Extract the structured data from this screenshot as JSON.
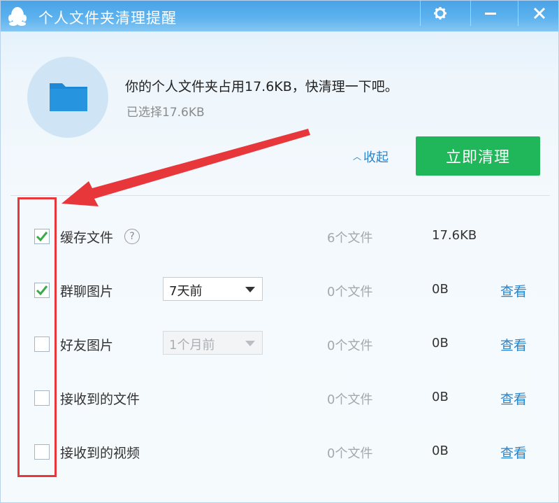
{
  "window": {
    "title": "个人文件夹清理提醒",
    "buttons": {
      "settings": "settings",
      "minimize": "minimize",
      "close": "close"
    }
  },
  "header": {
    "message": "你的个人文件夹占用17.6KB，快清理一下吧。",
    "selected": "已选择17.6KB",
    "collapse_label": "收起",
    "clean_button": "立即清理"
  },
  "rows": [
    {
      "label": "缓存文件",
      "checked": true,
      "help": "?",
      "count": "6个文件",
      "size": "17.6KB"
    },
    {
      "label": "群聊图片",
      "checked": true,
      "select": "7天前",
      "select_disabled": false,
      "count": "0个文件",
      "size": "0B",
      "view": "查看"
    },
    {
      "label": "好友图片",
      "checked": false,
      "select": "1个月前",
      "select_disabled": true,
      "count": "0个文件",
      "size": "0B",
      "view": "查看"
    },
    {
      "label": "接收到的文件",
      "checked": false,
      "count": "0个文件",
      "size": "0B",
      "view": "查看"
    },
    {
      "label": "接收到的视频",
      "checked": false,
      "count": "0个文件",
      "size": "0B",
      "view": "查看"
    }
  ],
  "colors": {
    "titlebar": "#4aa3e6",
    "accent_green": "#1fb75a",
    "link_blue": "#2b83c9",
    "annotation_red": "#e8373b",
    "check_green": "#3aa94a"
  },
  "icons": [
    "qq-penguin-icon",
    "gear-icon",
    "minimize-icon",
    "close-icon",
    "folder-icon",
    "chevron-up-icon",
    "help-icon",
    "checkmark-icon",
    "dropdown-arrow-icon"
  ]
}
